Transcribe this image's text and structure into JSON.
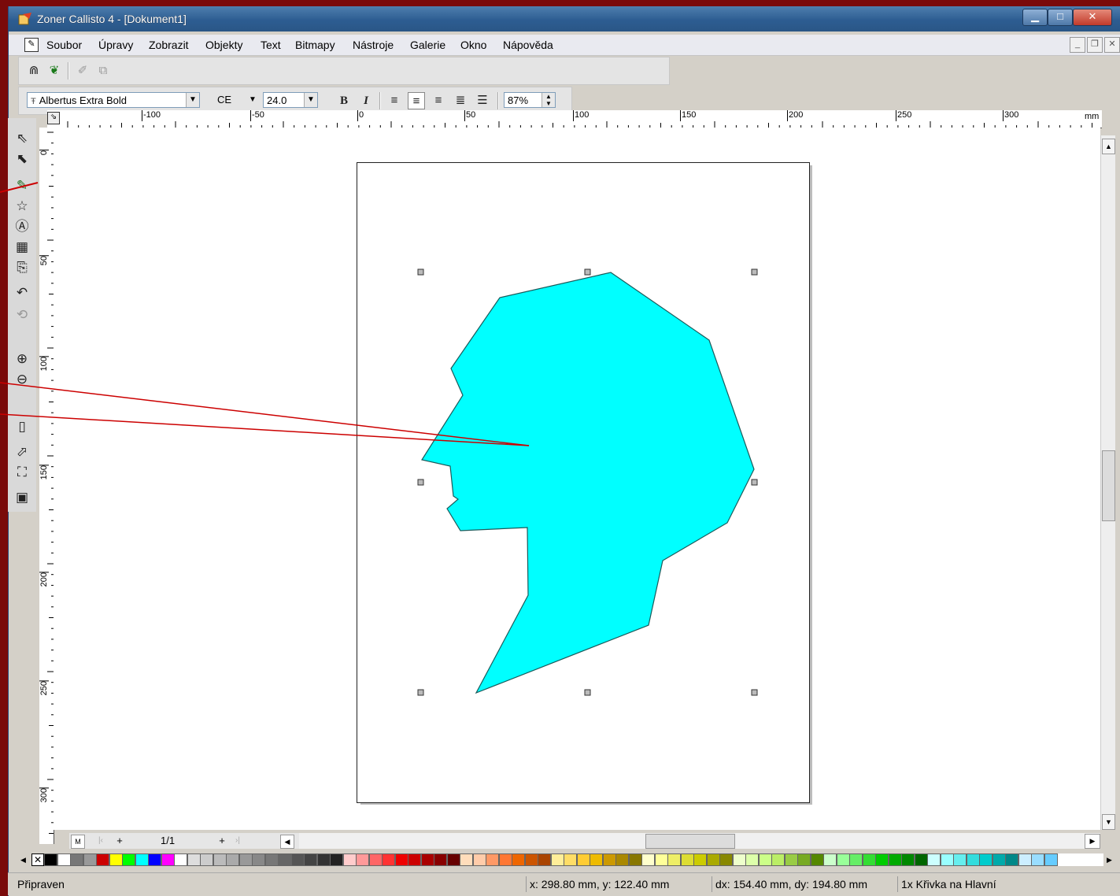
{
  "window": {
    "title": "Zoner Callisto 4 - [Dokument1]"
  },
  "menu": [
    "Soubor",
    "Úpravy",
    "Zobrazit",
    "Objekty",
    "Text",
    "Bitmapy",
    "Nástroje",
    "Galerie",
    "Okno",
    "Nápověda"
  ],
  "toolbar": {
    "font": "Albertus Extra Bold",
    "encoding": "CE",
    "size": "24.0",
    "bold": "B",
    "italic": "I",
    "zoom": "87%"
  },
  "ruler": {
    "unit": "mm",
    "h_labels": [
      "-100",
      "-50",
      "0",
      "50",
      "100",
      "150",
      "200",
      "250",
      "300"
    ],
    "v_labels": [
      "0",
      "50",
      "100",
      "150",
      "200",
      "250",
      "300"
    ]
  },
  "pagenav": {
    "page": "1/1"
  },
  "status": {
    "state": "Připraven",
    "coords": "x: 298.80 mm, y: 122.40 mm",
    "delta": "dx: 154.40 mm, dy: 194.80 mm",
    "selection": "1x Křivka na Hlavní"
  },
  "shape": {
    "fill": "#00ffff",
    "stroke": "#1a5a5a"
  },
  "callout": {
    "color": "#cc0000"
  }
}
